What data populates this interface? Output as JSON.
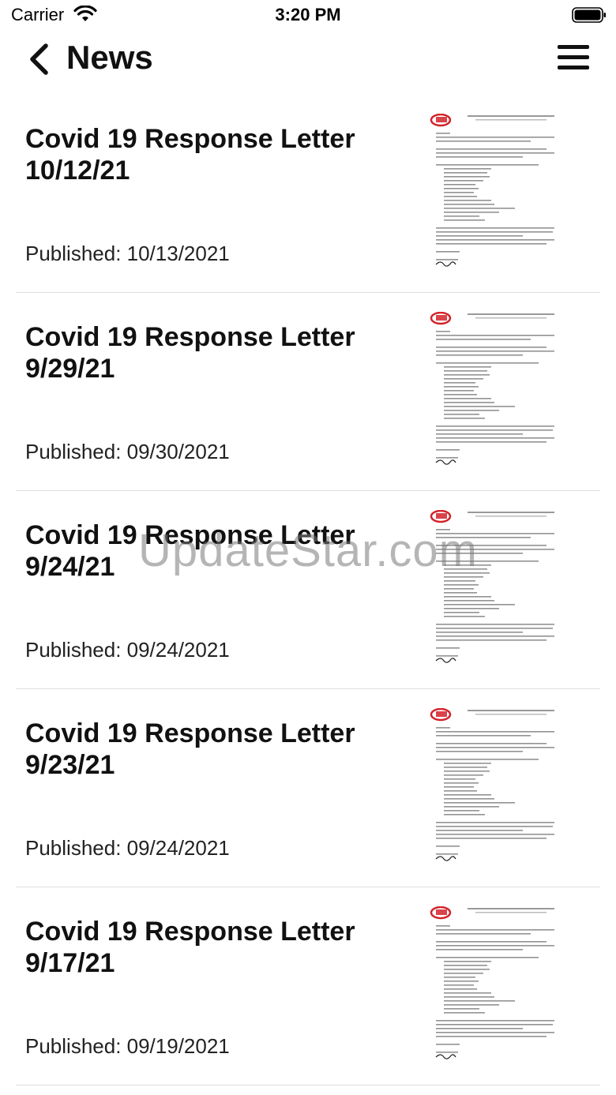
{
  "status_bar": {
    "carrier": "Carrier",
    "time": "3:20 PM"
  },
  "nav": {
    "title": "News",
    "back_icon": "chevron-left-icon",
    "menu_icon": "hamburger-menu-icon"
  },
  "news": [
    {
      "title": "Covid 19 Response Letter 10/12/21",
      "published": "Published: 10/13/2021"
    },
    {
      "title": "Covid 19 Response Letter 9/29/21",
      "published": "Published: 09/30/2021"
    },
    {
      "title": "Covid 19 Response Letter 9/24/21",
      "published": "Published: 09/24/2021"
    },
    {
      "title": "Covid 19 Response Letter 9/23/21",
      "published": "Published: 09/24/2021"
    },
    {
      "title": "Covid 19 Response Letter 9/17/21",
      "published": "Published: 09/19/2021"
    }
  ],
  "watermark": "UpdateStar.com",
  "colors": {
    "logo_red": "#d2232a",
    "divider": "#dedede",
    "text": "#111111"
  }
}
